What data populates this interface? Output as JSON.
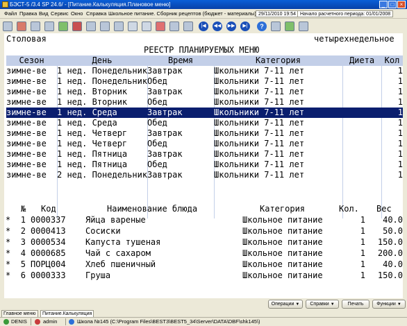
{
  "window": {
    "title": "БЭСТ-5 /3.4 SP 24.6/ - [Питание.Калькуляция.Плановое меню]"
  },
  "menu": {
    "items": [
      "Файл",
      "Правка",
      "Вид",
      "Сервис",
      "Окно",
      "Справка",
      "Школьное питание. Сборник рецептов (бюджет - материалы)"
    ],
    "date": "29/11/2010 19:54",
    "period_label": "Начало расчетного периода: 01/01/2008"
  },
  "toolbar": {
    "nav_first": "|◀",
    "nav_prev": "◀◀",
    "nav_next": "▶▶",
    "nav_last": "▶|",
    "help": "?"
  },
  "header": {
    "place": "Столовая",
    "menu_type": "четырехнедельное",
    "title": "РЕЕСТР ПЛАНИРУЕМЫХ МЕНЮ"
  },
  "grid": {
    "columns": [
      "Сезон",
      "День",
      "Время",
      "Категория",
      "Диета",
      "Кол"
    ],
    "rows": [
      {
        "season": "зимне-ве",
        "day": "1 нед. Понедельник",
        "time": "Завтрак",
        "category": "Школьники 7-11 лет",
        "diet": "",
        "qty": "1"
      },
      {
        "season": "зимне-ве",
        "day": "1 нед. Понедельник",
        "time": "Обед",
        "category": "Школьники 7-11 лет",
        "diet": "",
        "qty": "1"
      },
      {
        "season": "зимне-ве",
        "day": "1 нед. Вторник",
        "time": "Завтрак",
        "category": "Школьники 7-11 лет",
        "diet": "",
        "qty": "1"
      },
      {
        "season": "зимне-ве",
        "day": "1 нед. Вторник",
        "time": "Обед",
        "category": "Школьники 7-11 лет",
        "diet": "",
        "qty": "1"
      },
      {
        "season": "зимне-ве",
        "day": "1 нед. Среда",
        "time": "Завтрак",
        "category": "Школьники 7-11 лет",
        "diet": "",
        "qty": "1"
      },
      {
        "season": "зимне-ве",
        "day": "1 нед. Среда",
        "time": "Обед",
        "category": "Школьники 7-11 лет",
        "diet": "",
        "qty": "1"
      },
      {
        "season": "зимне-ве",
        "day": "1 нед. Четверг",
        "time": "Завтрак",
        "category": "Школьники 7-11 лет",
        "diet": "",
        "qty": "1"
      },
      {
        "season": "зимне-ве",
        "day": "1 нед. Четверг",
        "time": "Обед",
        "category": "Школьники 7-11 лет",
        "diet": "",
        "qty": "1"
      },
      {
        "season": "зимне-ве",
        "day": "1 нед. Пятница",
        "time": "Завтрак",
        "category": "Школьники 7-11 лет",
        "diet": "",
        "qty": "1"
      },
      {
        "season": "зимне-ве",
        "day": "1 нед. Пятница",
        "time": "Обед",
        "category": "Школьники 7-11 лет",
        "diet": "",
        "qty": "1"
      },
      {
        "season": "зимне-ве",
        "day": "2 нед. Понедельник",
        "time": "Завтрак",
        "category": "Школьники 7-11 лет",
        "diet": "",
        "qty": "1"
      }
    ],
    "selected_index": 4
  },
  "dishes": {
    "columns": [
      "№",
      "Код",
      "Наименование блюда",
      "Категория",
      "Кол.",
      "Вес"
    ],
    "rows": [
      {
        "mark": "*",
        "n": "1",
        "code": "0000337",
        "name": "Яйца вареные",
        "category": "Школьное питание",
        "qty": "1",
        "weight": "40.0"
      },
      {
        "mark": "*",
        "n": "2",
        "code": "0000413",
        "name": "Сосиски",
        "category": "Школьное питание",
        "qty": "1",
        "weight": "50.0"
      },
      {
        "mark": "*",
        "n": "3",
        "code": "0000534",
        "name": "Капуста тушеная",
        "category": "Школьное питание",
        "qty": "1",
        "weight": "150.0"
      },
      {
        "mark": "*",
        "n": "4",
        "code": "0000685",
        "name": "Чай с сахаром",
        "category": "Школьное питание",
        "qty": "1",
        "weight": "200.0"
      },
      {
        "mark": "*",
        "n": "5",
        "code": "ПОРЦ004",
        "name": "Хлеб пшеничный",
        "category": "Школьное питание",
        "qty": "1",
        "weight": "40.0"
      },
      {
        "mark": "*",
        "n": "6",
        "code": "0000333",
        "name": "Груша",
        "category": "Школьное питание",
        "qty": "1",
        "weight": "150.0"
      }
    ]
  },
  "buttons": {
    "operations": "Операции",
    "references": "Справки",
    "print": "Печать",
    "functions": "Функции"
  },
  "tabs": [
    "Главное меню",
    "Питание.Калькуляция"
  ],
  "status": {
    "host": "DENIS",
    "user": "admin",
    "path": "Школа №145 (C:\\Program Files\\BEST3\\BEST5_34\\Server\\DATA\\DBF\\shk145\\)"
  }
}
